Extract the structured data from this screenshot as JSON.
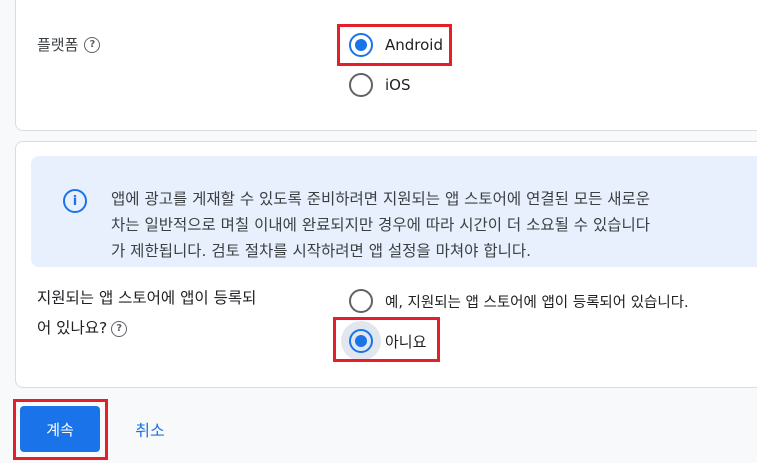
{
  "platform_section": {
    "label": "플랫폼",
    "help_icon": "question-circle-icon",
    "options": [
      {
        "label": "Android",
        "selected": true
      },
      {
        "label": "iOS",
        "selected": false
      }
    ]
  },
  "store_section": {
    "info_icon": "info-circle-icon",
    "info_lines": [
      "앱에 광고를 게재할 수 있도록 준비하려면 지원되는 앱 스토어에 연결된 모든 새로운",
      "차는 일반적으로 며칠 이내에 완료되지만 경우에 따라 시간이 더 소요될 수 있습니다",
      "가 제한됩니다. 검토 절차를 시작하려면 앱 설정을 마쳐야 합니다."
    ],
    "question_line1": "지원되는 앱 스토어에 앱이 등록되",
    "question_line2": "어 있나요?",
    "help_icon": "question-circle-icon",
    "options": [
      {
        "label": "예, 지원되는 앱 스토어에 앱이 등록되어 있습니다.",
        "selected": false
      },
      {
        "label": "아니요",
        "selected": true
      }
    ]
  },
  "actions": {
    "continue_label": "계속",
    "cancel_label": "취소"
  },
  "colors": {
    "accent": "#1a73e8",
    "highlight_box": "#e3202a",
    "info_background": "#e8f0fe"
  }
}
